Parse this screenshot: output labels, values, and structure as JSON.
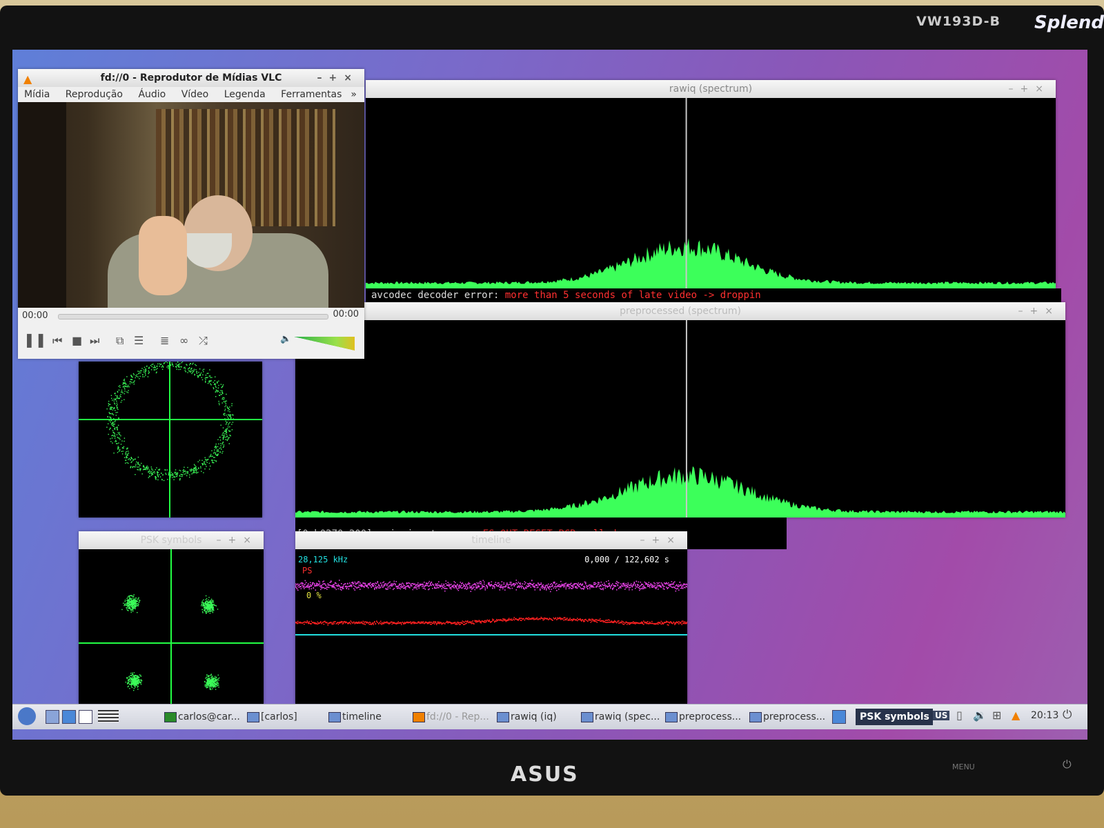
{
  "monitor": {
    "model": "VW193D-B",
    "splendid": "Splend",
    "brand": "ASUS",
    "menu_button": "MENU"
  },
  "vlc": {
    "title": "fd://0 - Reprodutor de Mídias VLC",
    "menu": [
      "Mídia",
      "Reprodução",
      "Áudio",
      "Vídeo",
      "Legenda",
      "Ferramentas"
    ],
    "overflow": "»",
    "time_elapsed": "00:00",
    "time_total": "00:00",
    "progress": 0
  },
  "rawiq_spectrum": {
    "title": "rawiq (spectrum)"
  },
  "console1": {
    "prefix": "avcodec decoder error: ",
    "error": "more than 5 seconds of late video -> droppin"
  },
  "preprocessed_spectrum": {
    "title": "preprocessed (spectrum)"
  },
  "console2": {
    "prefix": "[0xb0270e200] main input error: ",
    "error": "ES_OUT_RESET_PCR called"
  },
  "psk_symbols": {
    "title": "PSK symbols"
  },
  "timeline": {
    "title": "timeline",
    "freq": "28,125 kHz",
    "label_red": "PS",
    "label_pct": "0 %",
    "time": "0,000 / 122,602 s"
  },
  "taskbar": {
    "tasks": [
      {
        "label": "carlos@car..."
      },
      {
        "label": "[carlos]"
      },
      {
        "label": "timeline"
      },
      {
        "label": "fd://0 - Rep..."
      },
      {
        "label": "rawiq (iq)"
      },
      {
        "label": "rawiq (spec..."
      },
      {
        "label": "preprocess..."
      },
      {
        "label": "preprocess..."
      },
      {
        "label": "PSK symbols"
      }
    ],
    "kbd": "US",
    "clock": "20:13"
  },
  "colors": {
    "spectrum": "#3cff5a",
    "axis": "#c8c8c8",
    "grid": "#22ff44",
    "magenta": "#e040e0",
    "red": "#ff2020",
    "cyan": "#22e0e0"
  }
}
